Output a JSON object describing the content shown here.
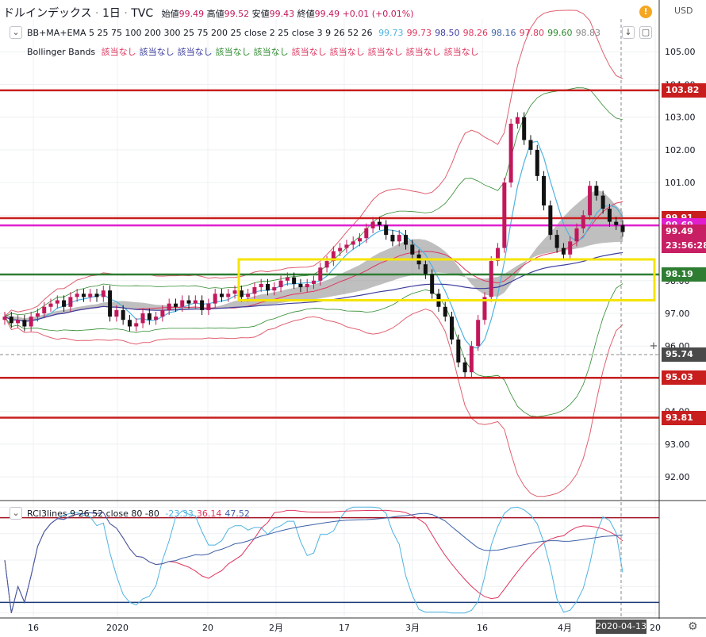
{
  "header": {
    "symbol": "ドルインデックス",
    "interval": "1日",
    "source": "TVC",
    "open_label": "始値",
    "open": "99.49",
    "high_label": "高値",
    "high": "99.52",
    "low_label": "安値",
    "low": "99.43",
    "close_label": "終値",
    "close": "99.49",
    "change": "+0.01 (+0.01%)",
    "currency": "USD"
  },
  "indicators": {
    "ma_title": "BB+MA+EMA 5 25 75 100 200 300 25 75 200 25 close 2 25 close 3 9 26 52 26",
    "ma_values": [
      {
        "text": "99.73",
        "color": "#4fb3e0"
      },
      {
        "text": "99.73",
        "color": "#e0365e"
      },
      {
        "text": "98.50",
        "color": "#3d3d9e"
      },
      {
        "text": "98.26",
        "color": "#e0365e"
      },
      {
        "text": "98.16",
        "color": "#3d60a8"
      },
      {
        "text": "97.80",
        "color": "#e0365e"
      },
      {
        "text": "99.60",
        "color": "#2e8b2e"
      },
      {
        "text": "98.83",
        "color": "#888888"
      }
    ],
    "bb_title": "Bollinger Bands",
    "bb_values": [
      {
        "text": "該当なし",
        "color": "#e0365e"
      },
      {
        "text": "該当なし",
        "color": "#3d3d9e"
      },
      {
        "text": "該当なし",
        "color": "#3d3d9e"
      },
      {
        "text": "該当なし",
        "color": "#2e8b2e"
      },
      {
        "text": "該当なし",
        "color": "#2e8b2e"
      },
      {
        "text": "該当なし",
        "color": "#e0365e"
      },
      {
        "text": "該当なし",
        "color": "#e0365e"
      },
      {
        "text": "該当なし",
        "color": "#e0365e"
      },
      {
        "text": "該当なし",
        "color": "#e0365e"
      },
      {
        "text": "該当なし",
        "color": "#e0365e"
      }
    ],
    "rci_title": "RCI3lines 9 26 52 close 80 -80",
    "rci_values": [
      {
        "text": "-23.33",
        "color": "#4fb3e0"
      },
      {
        "text": "36.14",
        "color": "#e0365e"
      },
      {
        "text": "47.52",
        "color": "#3d60a8"
      }
    ]
  },
  "price_tags": [
    {
      "text": "103.82",
      "value": 103.82,
      "color": "#c81e1e"
    },
    {
      "text": "99.91",
      "value": 99.91,
      "color": "#c81e1e"
    },
    {
      "text": "99.69",
      "value": 99.69,
      "color": "#e020d0"
    },
    {
      "text": "99.49",
      "value": 99.49,
      "color": "#c81e63"
    },
    {
      "text": "23:56:28",
      "value": 99.06,
      "color": "#c81e63"
    },
    {
      "text": "98.19",
      "value": 98.19,
      "color": "#2e7d32"
    },
    {
      "text": "95.74",
      "value": 95.74,
      "color": "#4a4a4a"
    },
    {
      "text": "95.03",
      "value": 95.03,
      "color": "#c81e1e"
    },
    {
      "text": "93.81",
      "value": 93.81,
      "color": "#c81e1e"
    }
  ],
  "cursor_date": "2020-04-13",
  "chart_data": [
    {
      "type": "candlestick",
      "title": "ドルインデックス 1日 TVC",
      "ylim": [
        91.3,
        106.0
      ],
      "y_ticks": [
        92.0,
        93.0,
        94.0,
        95.0,
        96.0,
        97.0,
        98.0,
        99.0,
        100.0,
        101.0,
        102.0,
        103.0,
        104.0,
        105.0
      ],
      "x_ticks": [
        "16",
        "2020",
        "20",
        "2月",
        "17",
        "3月",
        "16",
        "4月",
        "20"
      ],
      "horizontal_lines": [
        {
          "value": 103.82,
          "color": "#c81e1e"
        },
        {
          "value": 99.91,
          "color": "#c81e1e"
        },
        {
          "value": 99.69,
          "color": "#e020d0"
        },
        {
          "value": 98.19,
          "color": "#2e7d32"
        },
        {
          "value": 95.03,
          "color": "#c81e1e"
        },
        {
          "value": 93.81,
          "color": "#c81e1e"
        }
      ],
      "highlight_box": {
        "y_min": 97.4,
        "y_max": 98.65,
        "color": "#f5e400"
      },
      "closes": [
        96.9,
        96.7,
        96.8,
        96.6,
        96.9,
        97.0,
        97.2,
        97.3,
        97.4,
        97.2,
        97.5,
        97.6,
        97.5,
        97.6,
        97.5,
        97.7,
        96.9,
        97.1,
        96.8,
        96.6,
        96.7,
        97.0,
        96.8,
        96.9,
        97.1,
        97.3,
        97.2,
        97.4,
        97.3,
        97.4,
        97.1,
        97.3,
        97.6,
        97.5,
        97.6,
        97.7,
        97.5,
        97.6,
        97.8,
        97.9,
        97.7,
        97.8,
        98.0,
        98.1,
        97.9,
        97.8,
        97.9,
        98.0,
        98.4,
        98.6,
        98.9,
        99.0,
        99.1,
        99.2,
        99.3,
        99.6,
        99.8,
        99.7,
        99.4,
        99.2,
        99.4,
        99.1,
        98.8,
        98.5,
        98.2,
        97.6,
        97.2,
        96.9,
        96.2,
        95.5,
        95.2,
        96.0,
        96.8,
        97.5,
        98.6,
        99.0,
        101.0,
        102.8,
        103.0,
        102.3,
        102.0,
        101.2,
        100.3,
        99.4,
        99.0,
        98.8,
        99.2,
        99.6,
        100.0,
        100.9,
        100.6,
        100.2,
        99.8,
        99.7,
        99.49
      ],
      "rci": {
        "ylim": [
          -105,
          105
        ],
        "y_ticks": [
          100.0,
          50.0,
          0.0,
          -50.0,
          -100.0
        ],
        "levels": [
          80,
          -80
        ],
        "series": [
          {
            "name": "RCI 9",
            "color": "#4fb3e0",
            "last": -23.33
          },
          {
            "name": "RCI 26",
            "color": "#e0365e",
            "last": 36.14
          },
          {
            "name": "RCI 52",
            "color": "#3d60a8",
            "last": 47.52
          }
        ]
      }
    }
  ]
}
